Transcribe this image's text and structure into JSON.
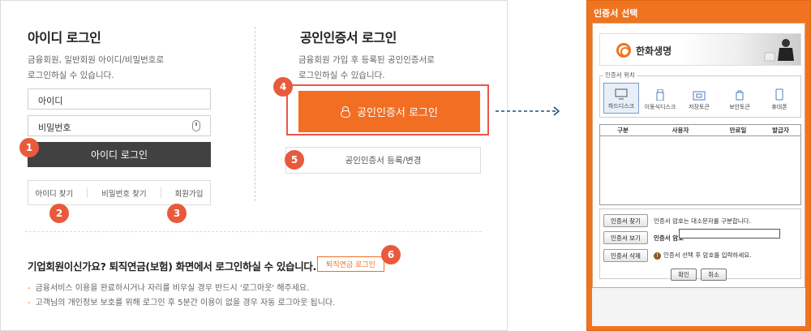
{
  "id_login": {
    "title": "아이디 로그인",
    "desc_line1": "금융회원, 일반회원 아이디/비밀번호로",
    "desc_line2": "로그인하실 수 있습니다.",
    "id_value": "아이디",
    "pw_value": "비밀번호",
    "login_button": "아이디 로그인",
    "links": [
      "아이디 찾기",
      "비밀번호 찾기",
      "회원가입"
    ]
  },
  "cert_login": {
    "title": "공인인증서 로그인",
    "desc_line1": "금융회원 가입 후 등록된 공인인증서로",
    "desc_line2": "로그인하실 수 있습니다.",
    "login_button": "공인인증서 로그인",
    "register_button": "공인인증서 등록/변경"
  },
  "corporate": {
    "question": "기업회원이신가요? 퇴직연금(보험) 화면에서 로그인하실 수 있습니다.",
    "button": "퇴직연금 로그인",
    "notes": [
      "금융서비스 이용을 완료하시거나 자리를 비우실 경우 반드시 '로그아웃' 해주세요.",
      "고객님의 개인정보 보호를 위해 로그인 후 5분간 이용이 없을 경우 자동 로그아웃 됩니다."
    ]
  },
  "badges": [
    "1",
    "2",
    "3",
    "4",
    "5",
    "6"
  ],
  "dialog": {
    "title": "인증서 선택",
    "brand": "한화생명",
    "location_label": "인증서 위치",
    "devices": [
      "하드디스크",
      "이동식디스크",
      "저장토큰",
      "보안토큰",
      "휴대폰"
    ],
    "table_headers": [
      "구분",
      "사용자",
      "만료일",
      "발급자"
    ],
    "find_button": "인증서 찾기",
    "view_button": "인증서 보기",
    "delete_button": "인증서 삭제",
    "case_note": "인증서 암호는 대소문자를 구분합니다.",
    "password_label": "인증서 암호",
    "select_note": "인증서 선택 후 암호를 입력하세요.",
    "ok_button": "확인",
    "cancel_button": "취소"
  },
  "colors": {
    "accent": "#f26e22",
    "badge": "#e85a3b",
    "dark_button": "#414141",
    "arrow": "#1f4e79"
  }
}
